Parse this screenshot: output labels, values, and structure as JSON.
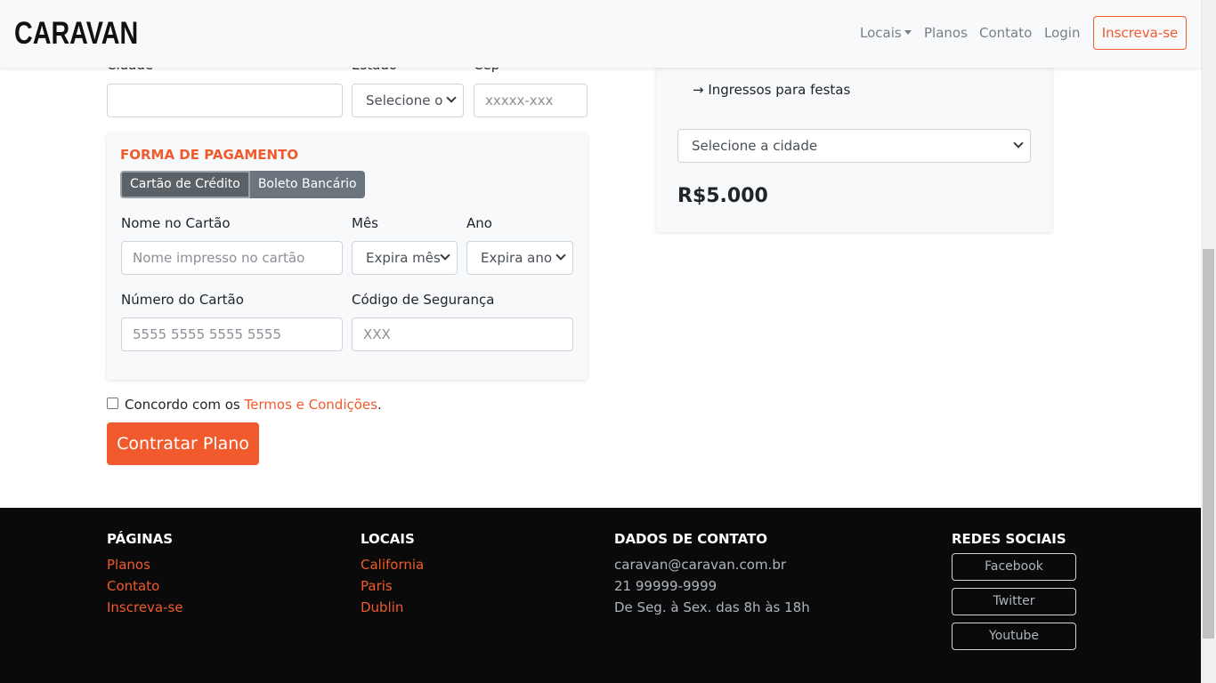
{
  "navbar": {
    "brand": "CARAVAN",
    "links": [
      "Locais",
      "Planos",
      "Contato",
      "Login"
    ],
    "signup": "Inscreva-se"
  },
  "address": {
    "city_label": "Cidade",
    "state_label": "Estado",
    "state_select": "Selecione o",
    "zip_label": "Cep",
    "zip_placeholder": "xxxxx-xxx"
  },
  "payment": {
    "title": "FORMA DE PAGAMENTO",
    "tabs": [
      "Cartão de Crédito",
      "Boleto Bancário"
    ],
    "name_label": "Nome no Cartão",
    "name_placeholder": "Nome impresso no cartão",
    "month_label": "Mês",
    "month_select": "Expira mês",
    "year_label": "Ano",
    "year_select": "Expira ano",
    "number_label": "Número do Cartão",
    "number_placeholder": "5555 5555 5555 5555",
    "cvv_label": "Código de Segurança",
    "cvv_placeholder": "XXX"
  },
  "agreement": {
    "prefix": "Concordo com os",
    "link": "Termos e Condições",
    "suffix": "."
  },
  "submit": "Contratar Plano",
  "summary": {
    "item": "→ Ingressos para festas",
    "city_select": "Selecione a cidade",
    "price": "R$5.000"
  },
  "footer": {
    "pages": {
      "title": "PÁGINAS",
      "links": [
        "Planos",
        "Contato",
        "Inscreva-se"
      ]
    },
    "locations": {
      "title": "LOCAIS",
      "links": [
        "California",
        "Paris",
        "Dublin"
      ]
    },
    "contact": {
      "title": "DADOS DE CONTATO",
      "lines": [
        "caravan@caravan.com.br",
        "21 99999-9999",
        "De Seg. à Sex. das 8h às 18h"
      ]
    },
    "social": {
      "title": "REDES SOCIAIS",
      "buttons": [
        "Facebook",
        "Twitter",
        "Youtube"
      ]
    }
  },
  "colors": {
    "accent": "#f05a2c",
    "footer_bg": "#0a0a0a",
    "card_bg": "#f8f9fa"
  }
}
